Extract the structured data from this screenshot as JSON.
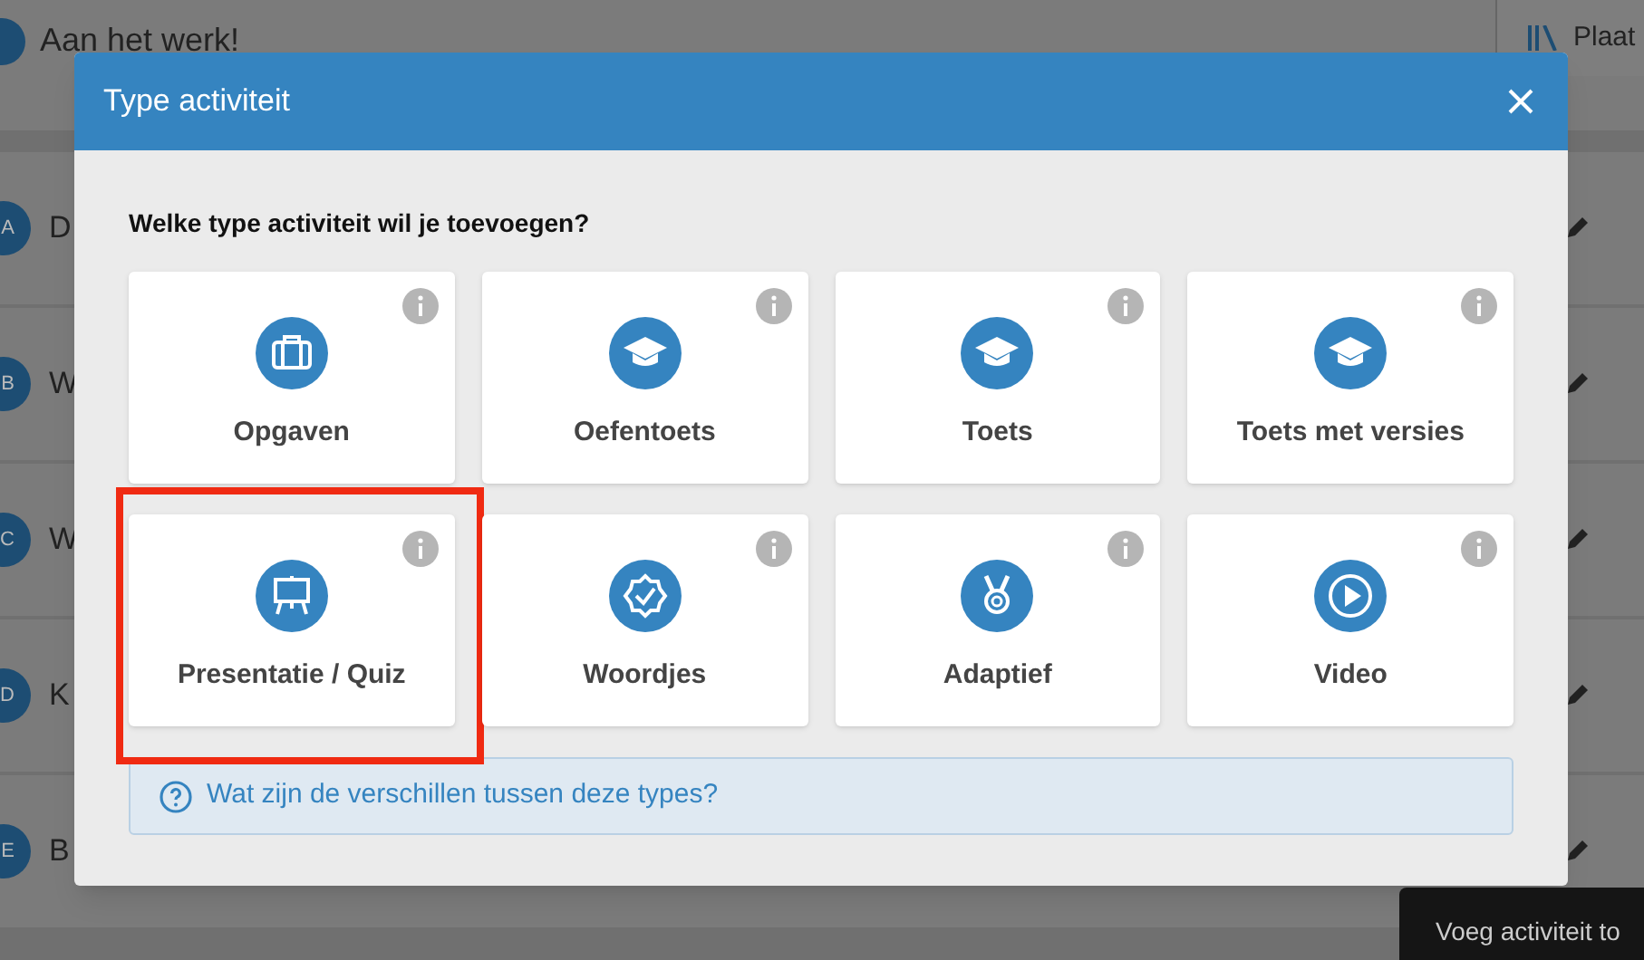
{
  "background": {
    "title": "Aan het werk!",
    "tab_label": "Plaat",
    "rows": [
      {
        "letter": "A",
        "title": "D"
      },
      {
        "letter": "B",
        "title": "W"
      },
      {
        "letter": "C",
        "title": "W"
      },
      {
        "letter": "D",
        "title": "K"
      },
      {
        "letter": "E",
        "title": "B"
      }
    ],
    "tooltip": "Voeg activiteit to"
  },
  "dialog": {
    "title": "Type activiteit",
    "question": "Welke type activiteit wil je toevoegen?",
    "options": [
      {
        "kind": "briefcase",
        "label": "Opgaven",
        "highlighted": false
      },
      {
        "kind": "cap",
        "label": "Oefentoets",
        "highlighted": false
      },
      {
        "kind": "cap",
        "label": "Toets",
        "highlighted": false
      },
      {
        "kind": "cap",
        "label": "Toets met versies",
        "highlighted": false
      },
      {
        "kind": "easel",
        "label": "Presentatie / Quiz",
        "highlighted": true
      },
      {
        "kind": "badge",
        "label": "Woordjes",
        "highlighted": false
      },
      {
        "kind": "medal",
        "label": "Adaptief",
        "highlighted": false
      },
      {
        "kind": "play",
        "label": "Video",
        "highlighted": false
      }
    ],
    "help_link": "Wat zijn de verschillen tussen deze types?"
  }
}
